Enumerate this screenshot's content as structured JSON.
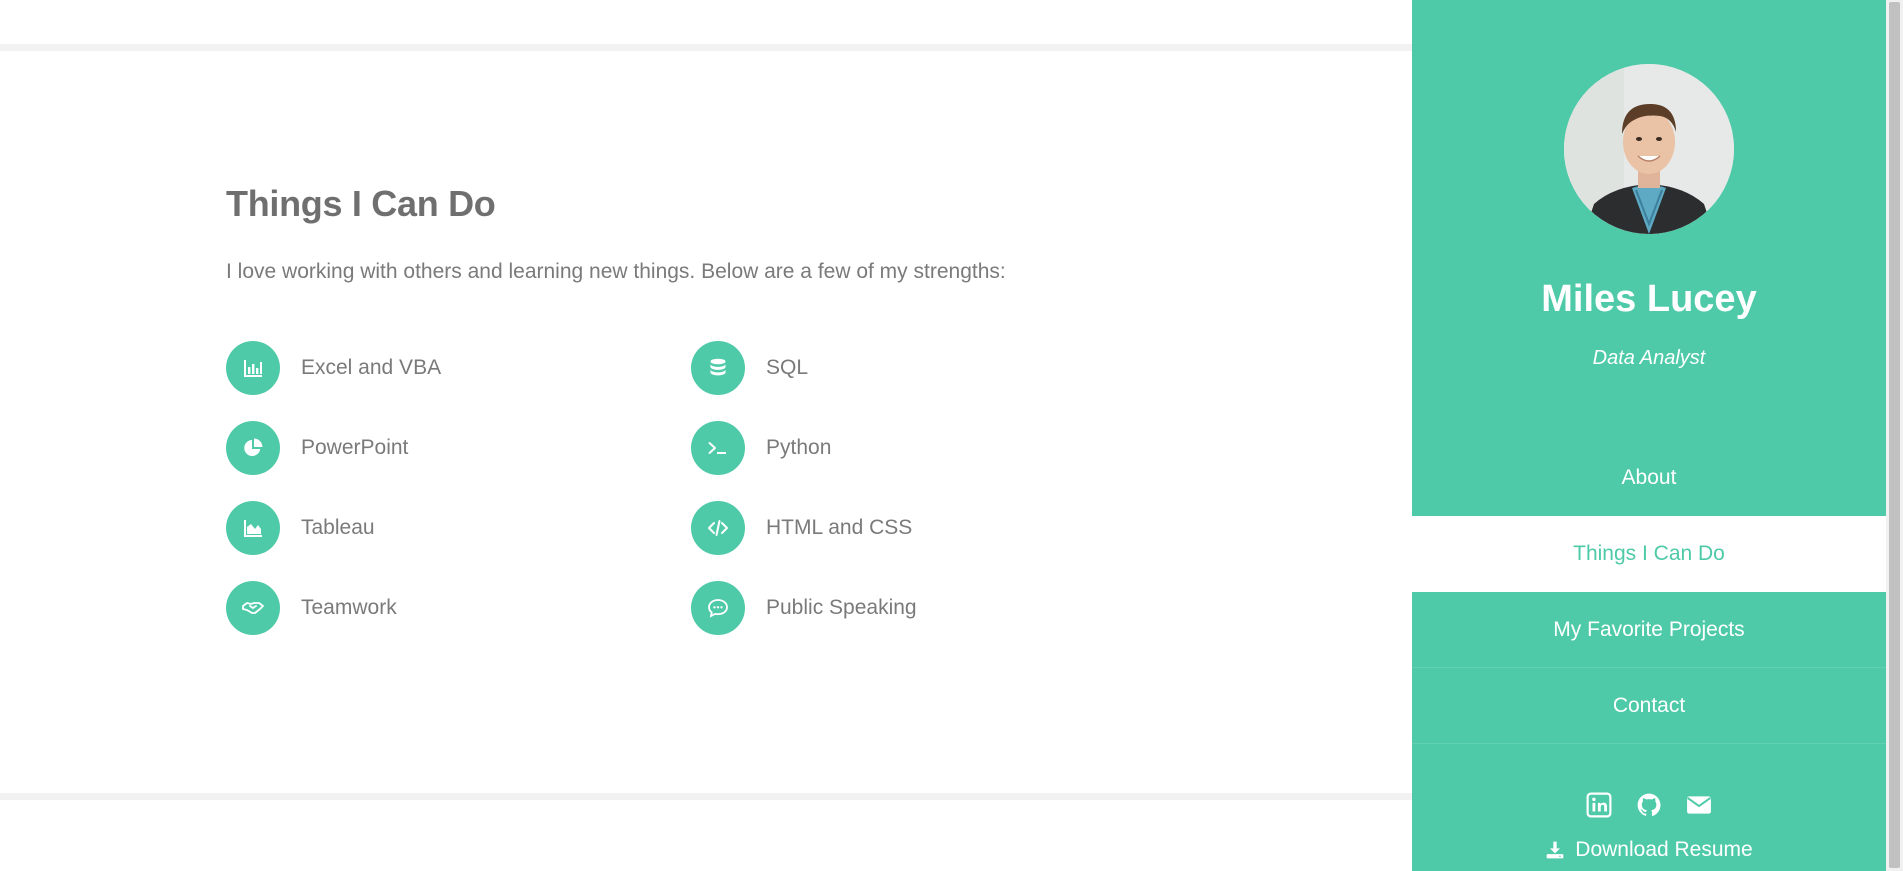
{
  "skills_section": {
    "title": "Things I Can Do",
    "intro": "I love working with others and learning new things. Below are a few of my strengths:",
    "items": [
      {
        "label": "Excel and VBA",
        "icon": "bar-chart-icon"
      },
      {
        "label": "SQL",
        "icon": "database-icon"
      },
      {
        "label": "PowerPoint",
        "icon": "pie-chart-icon"
      },
      {
        "label": "Python",
        "icon": "terminal-icon"
      },
      {
        "label": "Tableau",
        "icon": "area-chart-icon"
      },
      {
        "label": "HTML and CSS",
        "icon": "code-icon"
      },
      {
        "label": "Teamwork",
        "icon": "handshake-icon"
      },
      {
        "label": "Public Speaking",
        "icon": "speech-bubble-icon"
      }
    ]
  },
  "sidebar": {
    "name": "Miles Lucey",
    "role": "Data Analyst",
    "nav": [
      {
        "label": "About",
        "active": false
      },
      {
        "label": "Things I Can Do",
        "active": true
      },
      {
        "label": "My Favorite Projects",
        "active": false
      },
      {
        "label": "Contact",
        "active": false
      }
    ],
    "social": [
      "linkedin-icon",
      "github-icon",
      "envelope-icon"
    ],
    "resume_label": "Download Resume"
  },
  "colors": {
    "accent": "#4ecaa8",
    "text_gray": "#7a7a7a",
    "heading_gray": "#6f6f6f"
  }
}
